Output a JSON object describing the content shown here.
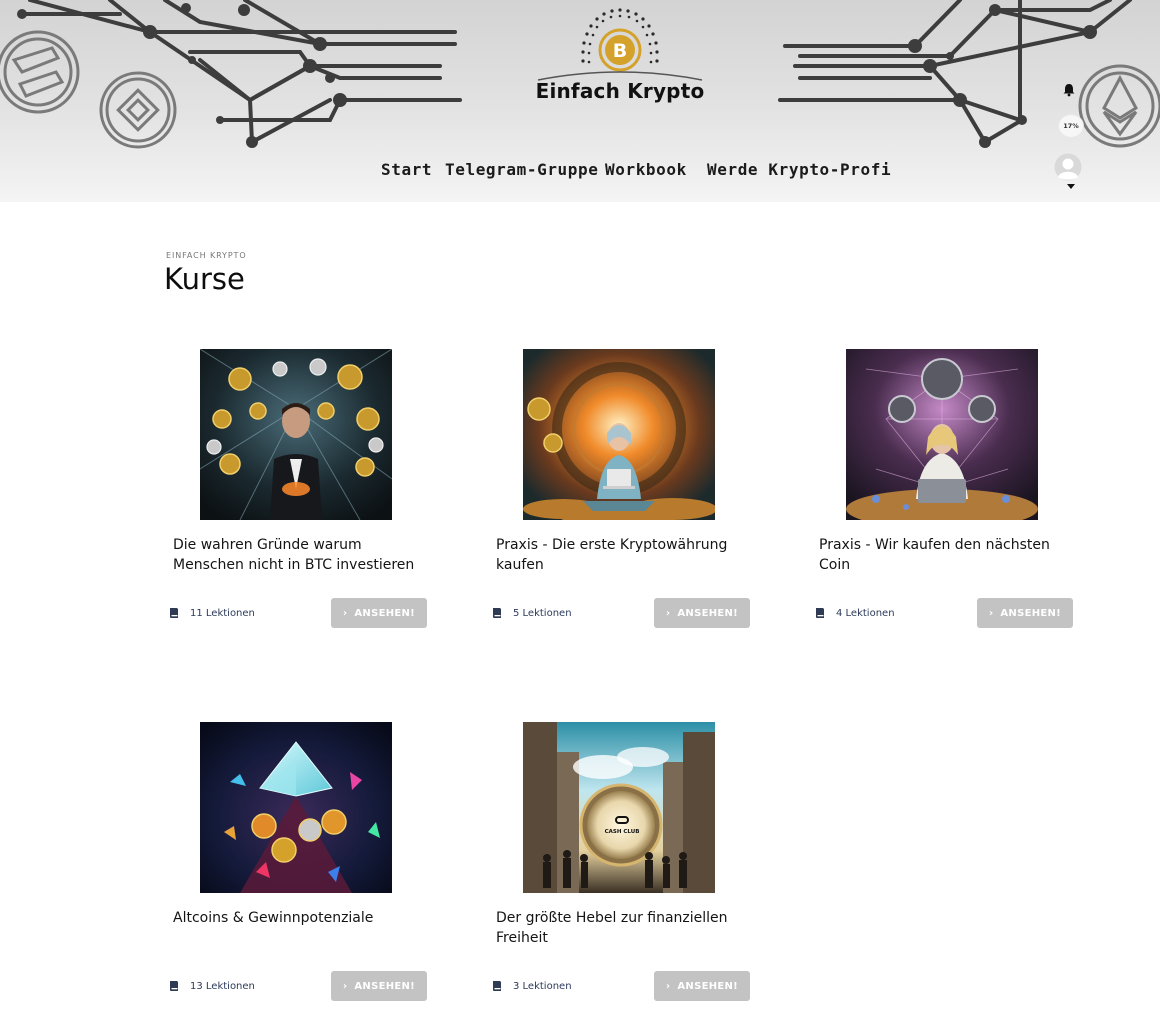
{
  "header": {
    "site_title": "Einfach Krypto",
    "nav": [
      "Start",
      "Telegram-Gruppe",
      "Workbook",
      "Werde Krypto-Profi"
    ],
    "progress": "17%"
  },
  "main": {
    "eyebrow": "EINFACH KRYPTO",
    "title": "Kurse",
    "courses": [
      {
        "title": "Die wahren Gründe warum Menschen nicht in BTC investieren",
        "lessons": "11 Lektionen",
        "button": "ANSEHEN!"
      },
      {
        "title": "Praxis - Die erste Kryptowährung kaufen",
        "lessons": "5 Lektionen",
        "button": "ANSEHEN!"
      },
      {
        "title": "Praxis - Wir kaufen den nächsten Coin",
        "lessons": "4 Lektionen",
        "button": "ANSEHEN!"
      },
      {
        "title": "Altcoins & Gewinnpotenziale",
        "lessons": "13 Lektionen",
        "button": "ANSEHEN!"
      },
      {
        "title": "Der größte Hebel zur finanziellen Freiheit",
        "lessons": "3 Lektionen",
        "button": "ANSEHEN!"
      }
    ],
    "thumb_badge": "CASH CLUB"
  },
  "colors": {
    "accent_gold": "#d4a22a",
    "button_bg": "#c3c3c3",
    "lesson_text": "#2c3a5a"
  },
  "icons": {
    "notification": "bell-icon",
    "lessons": "book-icon",
    "button": "chevron-right-icon",
    "logo": "bitcoin-logo"
  }
}
